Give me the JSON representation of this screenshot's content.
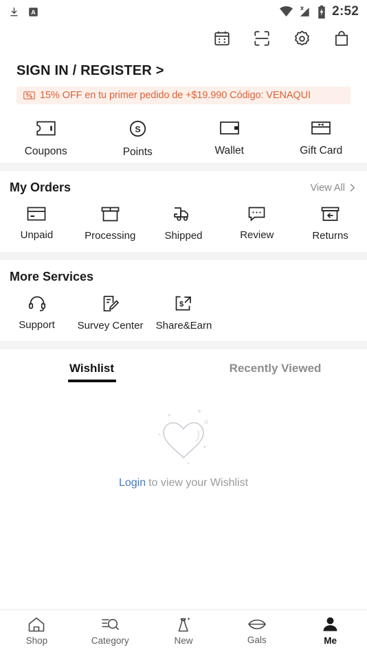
{
  "status_bar": {
    "left_icons": [
      "download-icon",
      "app-badge-icon"
    ],
    "right_icons": [
      "wifi-icon",
      "signal-no-service-icon",
      "battery-charging-icon"
    ],
    "time": "2:52"
  },
  "toolbar": {
    "items": [
      {
        "name": "checkin-calendar-icon",
        "label": "Check In"
      },
      {
        "name": "scan-icon",
        "label": "Scan"
      },
      {
        "name": "settings-gear-icon",
        "label": "Settings"
      },
      {
        "name": "shopping-bag-icon",
        "label": "Bag"
      }
    ]
  },
  "account": {
    "sign_in_label": "SIGN IN / REGISTER >",
    "promo": {
      "icon": "coupon-percent-icon",
      "text": "15% OFF en tu primer pedido de +$19.990 Código: VENAQUI",
      "text_color": "#d9633a",
      "background_color": "#fdf0ea"
    }
  },
  "quick_access": {
    "items": [
      {
        "label": "Coupons",
        "icon": "coupon-ticket-icon"
      },
      {
        "label": "Points",
        "icon": "points-coin-icon"
      },
      {
        "label": "Wallet",
        "icon": "wallet-icon"
      },
      {
        "label": "Gift Card",
        "icon": "gift-card-icon"
      }
    ]
  },
  "my_orders": {
    "title": "My Orders",
    "view_all_label": "View All",
    "view_all_icon": "chevron-right-icon",
    "items": [
      {
        "label": "Unpaid",
        "icon": "credit-card-icon"
      },
      {
        "label": "Processing",
        "icon": "package-box-icon"
      },
      {
        "label": "Shipped",
        "icon": "delivery-truck-icon"
      },
      {
        "label": "Review",
        "icon": "chat-bubble-icon"
      },
      {
        "label": "Returns",
        "icon": "return-box-icon"
      }
    ]
  },
  "more_services": {
    "title": "More Services",
    "items": [
      {
        "label": "Support",
        "icon": "headset-icon"
      },
      {
        "label": "Survey Center",
        "icon": "survey-pencil-icon"
      },
      {
        "label": "Share&Earn",
        "icon": "share-earn-icon"
      }
    ]
  },
  "wishlist_panel": {
    "tabs": [
      {
        "label": "Wishlist",
        "active": true
      },
      {
        "label": "Recently Viewed",
        "active": false
      }
    ],
    "empty_state": {
      "icon": "heart-outline-icon",
      "login_label": "Login",
      "message": "to view your Wishlist",
      "login_color": "#4a79b8"
    }
  },
  "bottom_nav": {
    "items": [
      {
        "label": "Shop",
        "icon": "home-icon",
        "active": false
      },
      {
        "label": "Category",
        "icon": "search-list-icon",
        "active": false
      },
      {
        "label": "New",
        "icon": "dress-icon",
        "active": false
      },
      {
        "label": "Gals",
        "icon": "lips-icon",
        "active": false
      },
      {
        "label": "Me",
        "icon": "person-icon",
        "active": true
      }
    ]
  }
}
